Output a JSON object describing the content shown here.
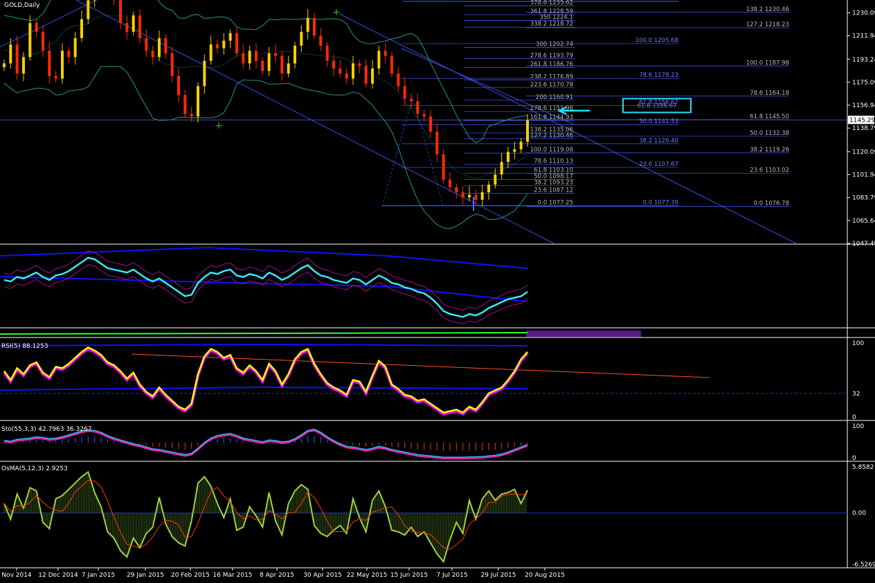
{
  "window": {
    "symbol_label": "GOLD,Daily"
  },
  "colors": {
    "background": "#000000",
    "candle_up": "#f5d000",
    "candle_down": "#ff2a00",
    "bollinger": "#1e9a8a",
    "trendline": "#3c4ce8",
    "fib_line": "#4a5cff",
    "fib_text": "#b8b8b8",
    "fib_text_blue": "#6e7dff",
    "rsi_main": "#ffff00",
    "rsi_shadow": "#ff00ff",
    "cci_main": "#38e8ff",
    "osma_hist": "#a4d23c",
    "osma_signal": "#ff3a00",
    "highlight_box": "#1ee0ff",
    "axis_text": "#ffffff",
    "grid_zero": "#2030c0"
  },
  "chart_data": [
    {
      "type": "candlestick",
      "title": "GOLD,Daily",
      "x": [
        "Nov 2014",
        "12 Dec 2014",
        "7 Jan 2015",
        "29 Jan 2015",
        "20 Feb 2015",
        "16 Mar 2015",
        "8 Apr 2015",
        "30 Apr 2015",
        "22 May 2015",
        "15 Jun 2015",
        "7 Jul 2015",
        "29 Jul 2015",
        "20 Aug 2015"
      ],
      "y_ticks": [
        "1230.09",
        "1211.94",
        "1193.24",
        "1175.09",
        "1156.94",
        "1138.79",
        "1120.09",
        "1101.94",
        "1083.79",
        "1065.64",
        "1047.49"
      ],
      "ylim": [
        1047.49,
        1238
      ],
      "current_price": "1145.29",
      "price_path": [
        1190,
        1205,
        1182,
        1195,
        1222,
        1215,
        1200,
        1180,
        1178,
        1200,
        1195,
        1210,
        1225,
        1240,
        1258,
        1268,
        1248,
        1240,
        1222,
        1215,
        1228,
        1210,
        1200,
        1195,
        1210,
        1198,
        1180,
        1165,
        1150,
        1148,
        1172,
        1192,
        1205,
        1202,
        1208,
        1214,
        1198,
        1190,
        1200,
        1192,
        1184,
        1198,
        1196,
        1182,
        1190,
        1204,
        1215,
        1226,
        1212,
        1204,
        1192,
        1186,
        1182,
        1178,
        1190,
        1188,
        1174,
        1186,
        1200,
        1196,
        1182,
        1172,
        1162,
        1160,
        1150,
        1148,
        1136,
        1118,
        1098,
        1092,
        1088,
        1084,
        1086,
        1082,
        1088,
        1094,
        1102,
        1112,
        1120,
        1122,
        1128,
        1145
      ],
      "fib_levels_left": [
        {
          "label": "378.6 1235.62",
          "price": 1235.62
        },
        {
          "label": "361.8 1228.59",
          "price": 1228.59
        },
        {
          "label": "350 1224.1",
          "price": 1224.1
        },
        {
          "label": "338.2 1218.72",
          "price": 1218.72
        },
        {
          "label": "300 1202.74",
          "price": 1202.74
        },
        {
          "label": "278.6 1193.79",
          "price": 1193.79
        },
        {
          "label": "261.8 1186.76",
          "price": 1186.76
        },
        {
          "label": "238.2 1176.89",
          "price": 1176.89
        },
        {
          "label": "223.6 1170.78",
          "price": 1170.78
        },
        {
          "label": "200 1160.91",
          "price": 1160.91
        },
        {
          "label": "178.6 1151.96",
          "price": 1151.96
        },
        {
          "label": "161.8 1144.93",
          "price": 1144.93
        },
        {
          "label": "138.2 1135.06",
          "price": 1135.06
        },
        {
          "label": "127.2 1130.46",
          "price": 1130.46
        },
        {
          "label": "100.0 1119.08",
          "price": 1119.08
        },
        {
          "label": "78.6 1110.13",
          "price": 1110.13
        },
        {
          "label": "61.8 1103.10",
          "price": 1103.1
        },
        {
          "label": "50.0 1098.17",
          "price": 1098.17
        },
        {
          "label": "38.2 1093.23",
          "price": 1093.23
        },
        {
          "label": "23.6 1087.12",
          "price": 1087.12
        },
        {
          "label": "0.0 1077.25",
          "price": 1077.25
        }
      ],
      "fib_levels_mid": [
        {
          "label": "100.0 1205.68",
          "price": 1205.68
        },
        {
          "label": "78.6 1178.23",
          "price": 1178.23
        },
        {
          "label": "61.8 1156.67",
          "price": 1156.67
        },
        {
          "label": "50.0 1141.53",
          "price": 1141.53
        },
        {
          "label": "38.2 1126.40",
          "price": 1126.4
        },
        {
          "label": "23.6 1107.67",
          "price": 1107.67
        },
        {
          "label": "0.0 1077.39",
          "price": 1077.39
        }
      ],
      "fib_levels_right": [
        {
          "label": "138.2 1230.46",
          "price": 1230.46
        },
        {
          "label": "127.2 1218.23",
          "price": 1218.23
        },
        {
          "label": "100.0 1187.98",
          "price": 1187.98
        },
        {
          "label": "78.6 1164.18",
          "price": 1164.18
        },
        {
          "label": "61.8 1145.50",
          "price": 1145.5
        },
        {
          "label": "50.0 1132.38",
          "price": 1132.38
        },
        {
          "label": "38.2 1119.26",
          "price": 1119.26
        },
        {
          "label": "23.6 1103.02",
          "price": 1103.02
        },
        {
          "label": "0.0 1076.78",
          "price": 1076.78
        }
      ],
      "highlighted_level": "61.8 1156.67"
    },
    {
      "type": "line",
      "title": "",
      "ylim": [
        0,
        100
      ],
      "values": [
        60,
        58,
        64,
        62,
        66,
        70,
        64,
        60,
        66,
        68,
        72,
        78,
        84,
        90,
        88,
        82,
        76,
        74,
        72,
        70,
        74,
        68,
        62,
        58,
        62,
        56,
        50,
        44,
        38,
        40,
        56,
        64,
        70,
        68,
        72,
        74,
        66,
        64,
        68,
        66,
        62,
        70,
        66,
        60,
        64,
        70,
        76,
        80,
        72,
        66,
        64,
        60,
        58,
        56,
        62,
        60,
        54,
        60,
        66,
        62,
        56,
        54,
        50,
        48,
        44,
        42,
        36,
        28,
        18,
        14,
        12,
        10,
        14,
        12,
        16,
        22,
        26,
        30,
        34,
        36,
        38,
        44
      ]
    },
    {
      "type": "line",
      "title": "RSI(5) 88.1253",
      "y_ticks": [
        "100",
        "32",
        "0"
      ],
      "ylim": [
        0,
        100
      ],
      "values": [
        62,
        50,
        66,
        58,
        70,
        74,
        60,
        54,
        68,
        66,
        72,
        80,
        88,
        94,
        90,
        84,
        74,
        70,
        62,
        52,
        60,
        44,
        34,
        28,
        40,
        30,
        22,
        14,
        10,
        18,
        58,
        82,
        92,
        88,
        80,
        84,
        66,
        60,
        70,
        62,
        50,
        72,
        62,
        44,
        58,
        78,
        88,
        92,
        72,
        58,
        46,
        40,
        36,
        30,
        50,
        48,
        34,
        56,
        76,
        68,
        44,
        38,
        30,
        28,
        22,
        24,
        18,
        12,
        6,
        8,
        10,
        6,
        14,
        10,
        20,
        32,
        36,
        40,
        50,
        62,
        78,
        88
      ]
    },
    {
      "type": "line",
      "title": "Sto(55,3,3) 42.7963 36.3267",
      "y_ticks": [
        "100",
        "0"
      ],
      "ylim": [
        0,
        100
      ],
      "values": [
        55,
        52,
        58,
        60,
        62,
        66,
        64,
        60,
        62,
        66,
        72,
        78,
        84,
        88,
        86,
        80,
        70,
        62,
        56,
        50,
        44,
        40,
        34,
        28,
        26,
        22,
        18,
        14,
        10,
        14,
        30,
        48,
        62,
        70,
        74,
        76,
        70,
        62,
        58,
        54,
        50,
        56,
        54,
        50,
        52,
        60,
        72,
        86,
        90,
        80,
        66,
        54,
        44,
        36,
        34,
        30,
        26,
        30,
        36,
        32,
        26,
        22,
        18,
        14,
        10,
        8,
        6,
        4,
        2,
        2,
        2,
        2,
        3,
        3,
        4,
        6,
        8,
        12,
        18,
        26,
        34,
        42
      ]
    },
    {
      "type": "bar",
      "title": "OsMA(5,12,3) 2.9253",
      "y_ticks": [
        "5.8582",
        "0.00",
        "-6.5269"
      ],
      "ylim": [
        -6.5269,
        5.8582
      ],
      "values": [
        1.2,
        -0.8,
        2.4,
        0.6,
        3.2,
        2.8,
        -1.2,
        -2.0,
        1.8,
        2.2,
        3.0,
        3.8,
        4.6,
        5.2,
        2.6,
        0.8,
        -2.4,
        -3.2,
        -4.8,
        -5.6,
        -3.2,
        -4.4,
        -2.6,
        -1.8,
        2.0,
        -1.4,
        -3.0,
        -3.8,
        -4.2,
        -1.0,
        3.8,
        4.6,
        3.4,
        1.2,
        -0.6,
        1.8,
        -2.2,
        -1.8,
        0.8,
        -0.4,
        -1.8,
        2.6,
        -1.0,
        -2.8,
        1.2,
        2.8,
        3.6,
        3.0,
        -1.6,
        -2.6,
        -3.0,
        -2.2,
        -1.6,
        -2.6,
        1.8,
        -0.6,
        -2.4,
        1.6,
        2.8,
        0.8,
        -2.2,
        -2.4,
        -2.8,
        -1.8,
        -3.0,
        -2.4,
        -3.8,
        -5.2,
        -6.2,
        -3.4,
        -1.2,
        -2.6,
        1.6,
        -0.8,
        1.8,
        2.8,
        1.6,
        2.4,
        2.6,
        3.0,
        1.2,
        2.9
      ]
    }
  ]
}
